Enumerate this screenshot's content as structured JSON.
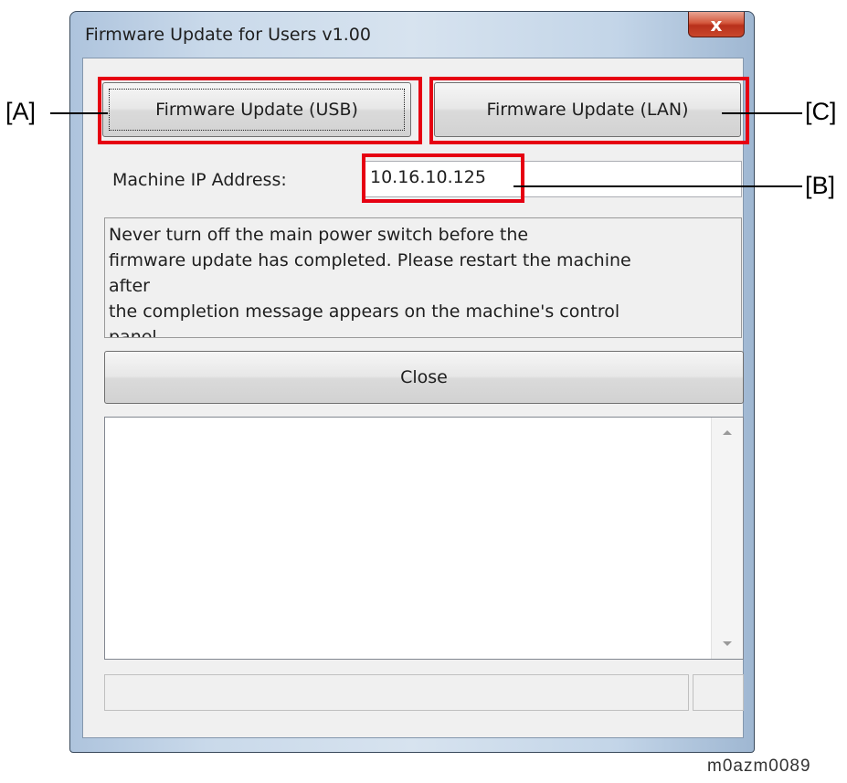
{
  "window": {
    "title": "Firmware Update for Users v1.00",
    "close_glyph": "x"
  },
  "buttons": {
    "usb": "Firmware Update (USB)",
    "lan": "Firmware Update (LAN)",
    "close": "Close"
  },
  "ip": {
    "label": "Machine IP Address:",
    "value": "10.16.10.125"
  },
  "message": {
    "lines": [
      "Never turn off the main power switch before the",
      "firmware update has completed. Please restart the machine",
      "after",
      "the completion message appears on the machine's control",
      "panel."
    ]
  },
  "callouts": {
    "a": "[A]",
    "b": "[B]",
    "c": "[C]",
    "color": "#e60012"
  },
  "figure_id": "m0azm0089"
}
